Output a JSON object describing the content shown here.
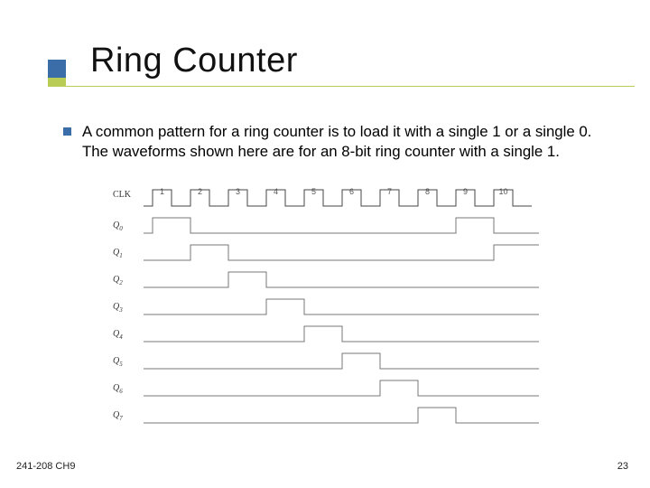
{
  "title": "Ring Counter",
  "bullet": "A common pattern for a ring counter is to load it with a single 1 or a single 0. The waveforms shown here are for an 8-bit ring counter with a single 1.",
  "footer_left": "241-208 CH9",
  "footer_right": "23",
  "diagram": {
    "clk_label": "CLK",
    "q_prefix": "Q",
    "clock_ticks": [
      "1",
      "2",
      "3",
      "4",
      "5",
      "6",
      "7",
      "8",
      "9",
      "10"
    ],
    "num_q": 8
  },
  "chart_data": {
    "type": "timing-diagram",
    "title": "8-bit ring counter waveforms",
    "clock_cycles": 10,
    "signals": [
      {
        "name": "Q0",
        "high_cycles": [
          1,
          9
        ]
      },
      {
        "name": "Q1",
        "high_cycles": [
          2,
          10
        ]
      },
      {
        "name": "Q2",
        "high_cycles": [
          3
        ]
      },
      {
        "name": "Q3",
        "high_cycles": [
          4
        ]
      },
      {
        "name": "Q4",
        "high_cycles": [
          5
        ]
      },
      {
        "name": "Q5",
        "high_cycles": [
          6
        ]
      },
      {
        "name": "Q6",
        "high_cycles": [
          7
        ]
      },
      {
        "name": "Q7",
        "high_cycles": [
          8
        ]
      }
    ]
  }
}
